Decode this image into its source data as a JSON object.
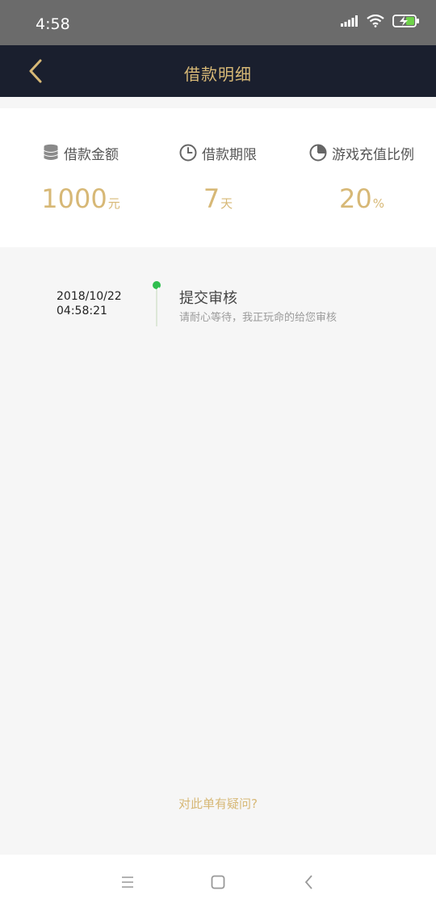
{
  "status_bar": {
    "time": "4:58",
    "icons": [
      "signal-icon",
      "wifi-icon",
      "battery-charging-icon"
    ]
  },
  "header": {
    "title": "借款明细",
    "back_icon": "back-chevron-icon",
    "accent_color": "#d7b876",
    "background_color": "#1a1f2e"
  },
  "summary": {
    "items": [
      {
        "icon": "coin-stack-icon",
        "label": "借款金额",
        "value": "1000",
        "unit": "元"
      },
      {
        "icon": "clock-icon",
        "label": "借款期限",
        "value": "7",
        "unit": "天"
      },
      {
        "icon": "pie-chart-icon",
        "label": "游戏充值比例",
        "value": "20",
        "unit": "%"
      }
    ]
  },
  "timeline": {
    "events": [
      {
        "date": "2018/10/22",
        "time": "04:58:21",
        "title": "提交审核",
        "description": "请耐心等待，我正玩命的给您审核",
        "status_color": "#2fbe4e"
      }
    ]
  },
  "footer": {
    "question_link": "对此单有疑问?"
  },
  "system_nav": {
    "buttons": [
      "menu-icon",
      "home-square-icon",
      "back-triangle-icon"
    ]
  }
}
